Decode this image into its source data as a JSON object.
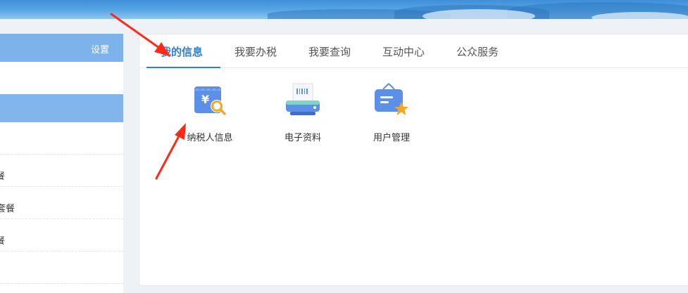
{
  "sidebar": {
    "settings_label": "设置",
    "items": [
      {
        "label": ""
      },
      {
        "label": "餐"
      },
      {
        "label": "套餐"
      },
      {
        "label": "餐"
      },
      {
        "label": ""
      }
    ]
  },
  "tabs": [
    {
      "label": "我的信息",
      "active": true
    },
    {
      "label": "我要办税",
      "active": false
    },
    {
      "label": "我要查询",
      "active": false
    },
    {
      "label": "互动中心",
      "active": false
    },
    {
      "label": "公众服务",
      "active": false
    }
  ],
  "tiles": [
    {
      "label": "纳税人信息",
      "icon": "taxpayer-info-icon"
    },
    {
      "label": "电子资料",
      "icon": "printer-icon"
    },
    {
      "label": "用户管理",
      "icon": "user-management-icon"
    }
  ],
  "colors": {
    "accent": "#2f7fd6",
    "sidebar_header": "#7eb2eb",
    "annotation": "#ff2a1a"
  }
}
